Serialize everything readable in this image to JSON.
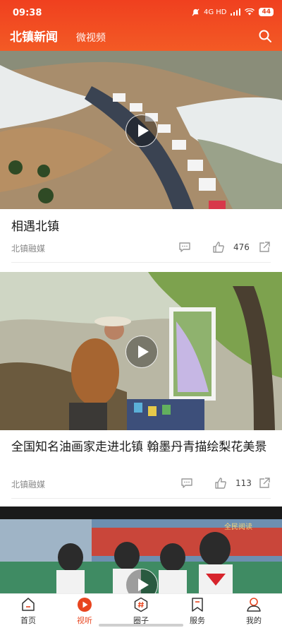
{
  "status_bar": {
    "time": "09:38",
    "network": "4G HD",
    "battery": "44"
  },
  "header": {
    "tabs": [
      {
        "label": "北镇新闻",
        "active": true
      },
      {
        "label": "微视频",
        "active": false
      }
    ],
    "search_icon": "search-icon"
  },
  "feed": {
    "items": [
      {
        "title": "相遇北镇",
        "source": "北镇融媒",
        "like_count": "476",
        "thumbnail": "aerial view of cars on road through blossoming pear orchards"
      },
      {
        "title": "全国知名油画家走进北镇 翰墨丹青描绘梨花美景",
        "source": "北镇融媒",
        "like_count": "113",
        "thumbnail": "painter at easel outdoors among blossoming trees"
      },
      {
        "title": "",
        "source": "",
        "like_count": "",
        "thumbnail": "students with red scarves on school sports field",
        "overlay_text": "全民阅读"
      }
    ]
  },
  "bottom_nav": {
    "items": [
      {
        "label": "首页",
        "icon": "home-icon",
        "active": false
      },
      {
        "label": "视听",
        "icon": "play-circle-icon",
        "active": true
      },
      {
        "label": "圈子",
        "icon": "hashtag-icon",
        "active": false
      },
      {
        "label": "服务",
        "icon": "bookmark-icon",
        "active": false
      },
      {
        "label": "我的",
        "icon": "user-icon",
        "active": false
      }
    ]
  },
  "colors": {
    "brand": "#e8451f",
    "header_gradient_top": "#f0401f",
    "header_gradient_bottom": "#f35a25"
  }
}
